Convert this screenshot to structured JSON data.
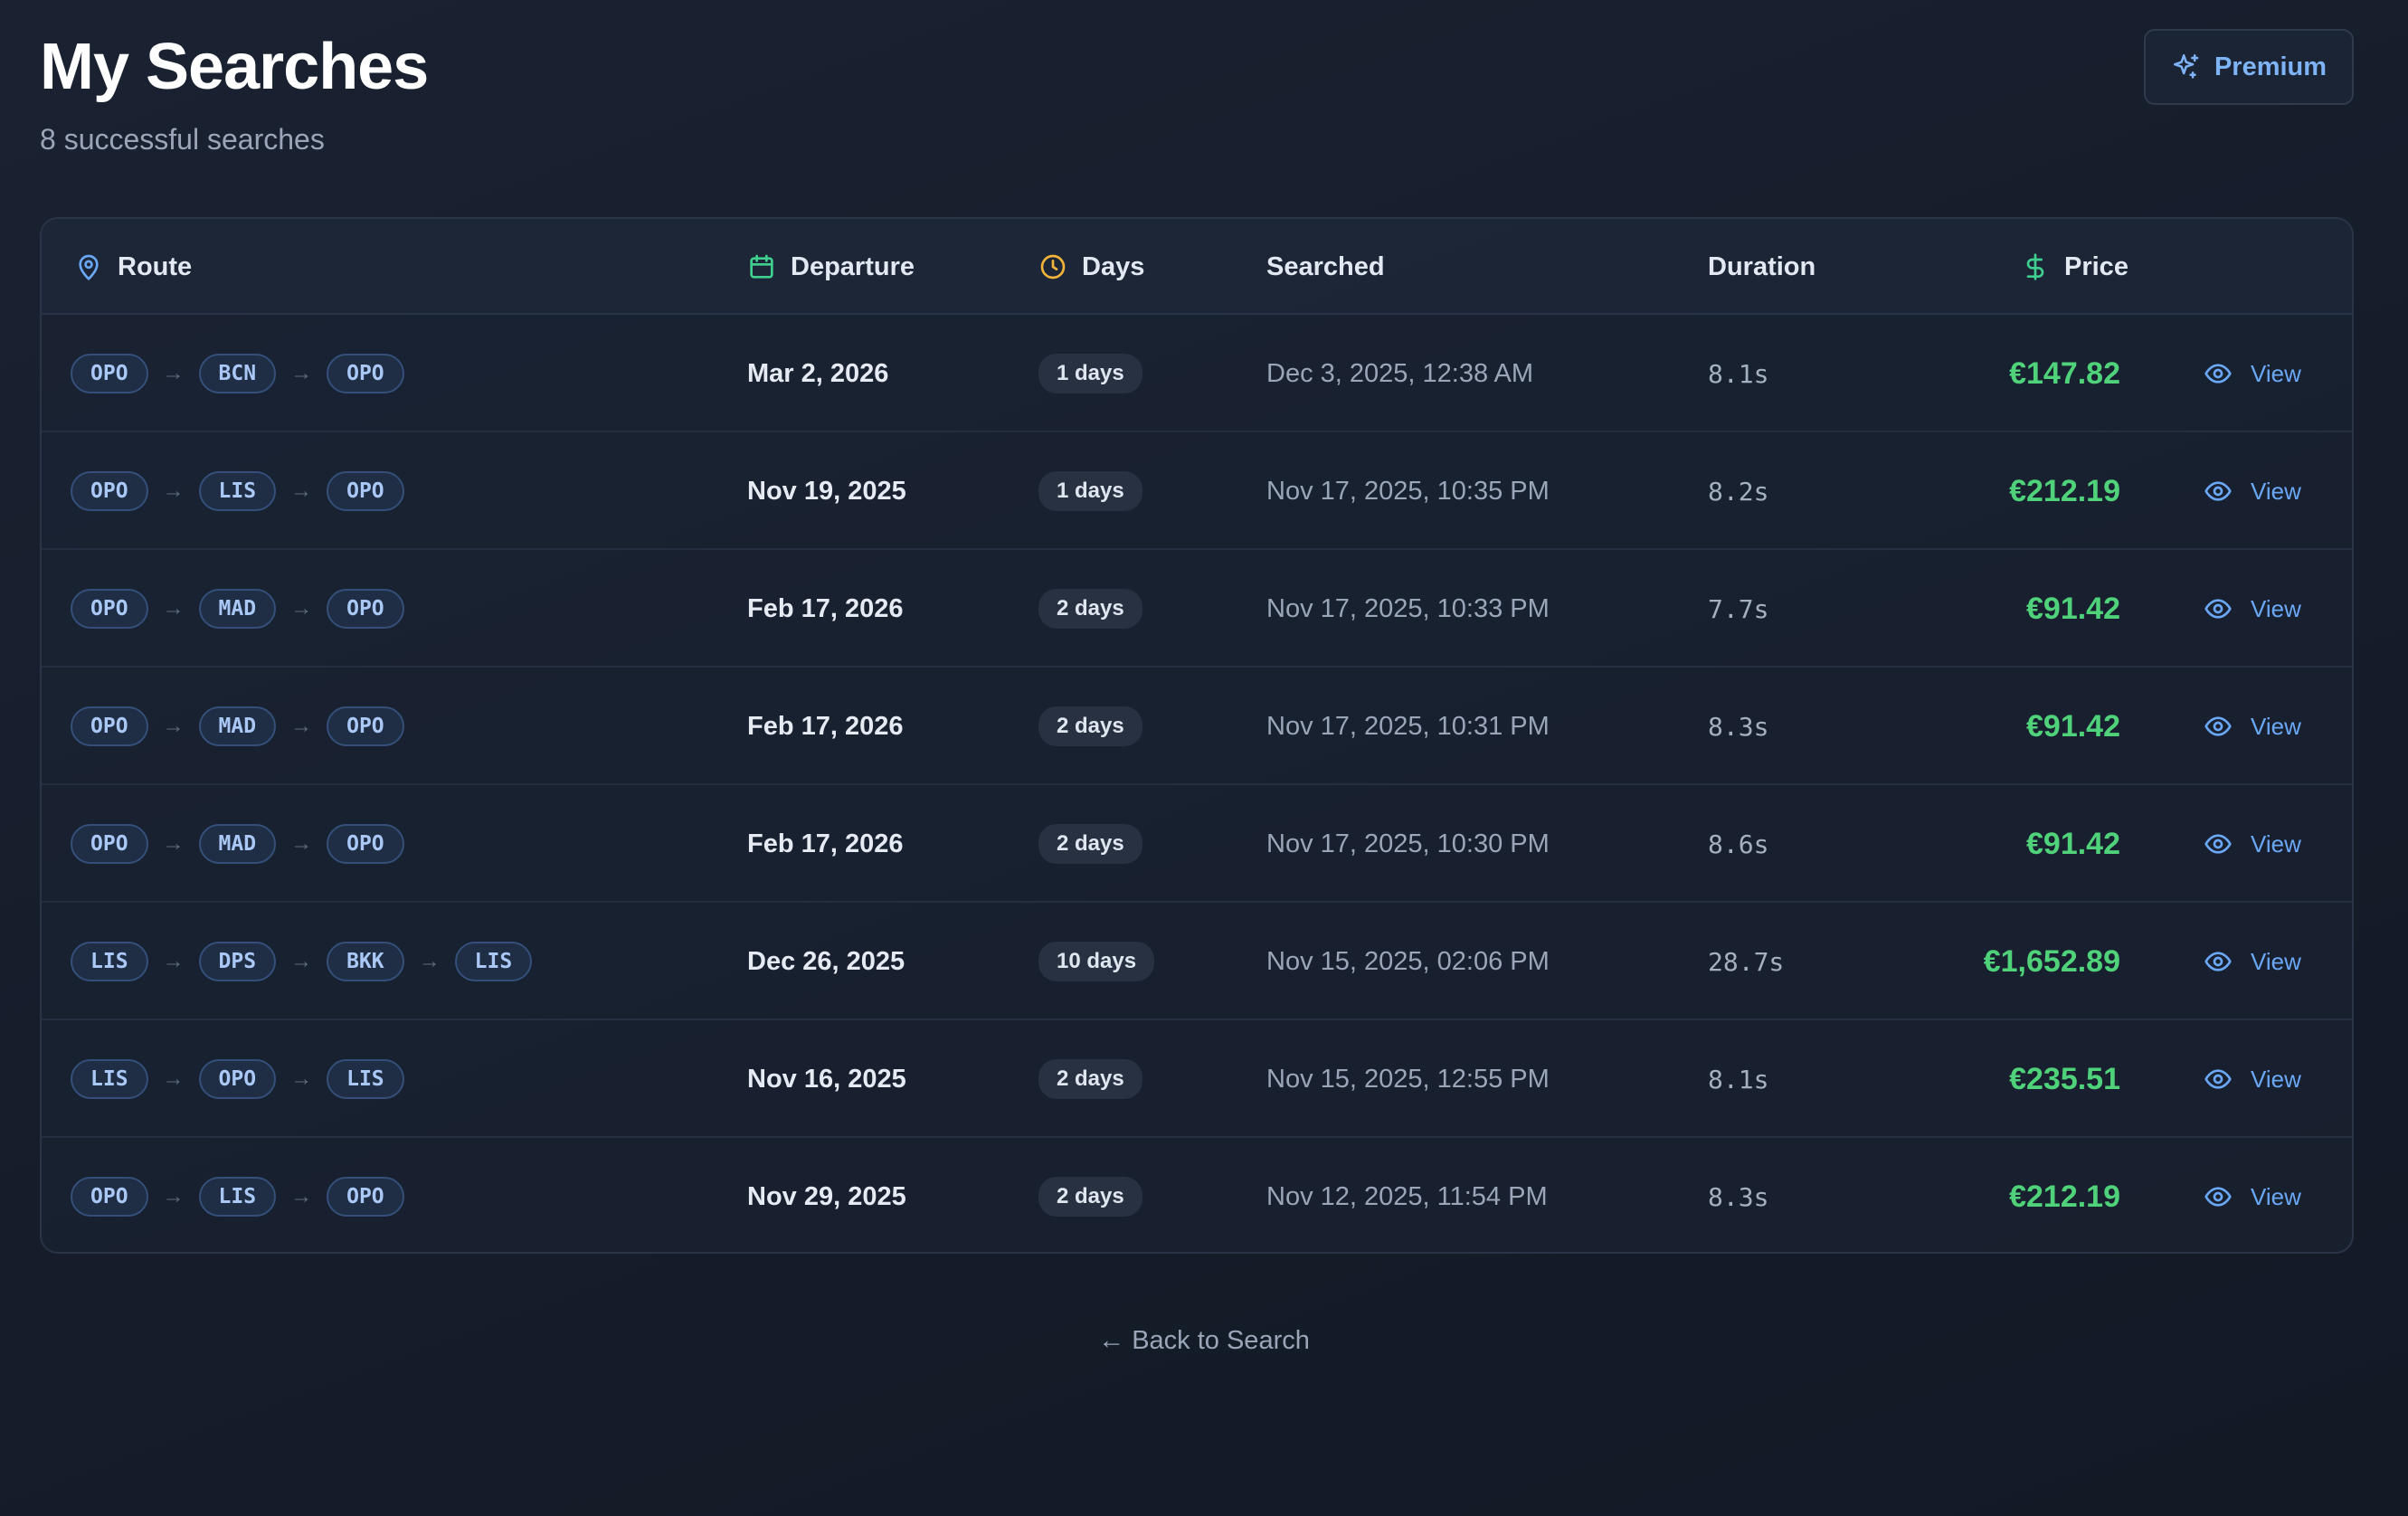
{
  "header": {
    "title": "My Searches",
    "subtitle": "8 successful searches",
    "premium_label": "Premium"
  },
  "table": {
    "columns": {
      "route": "Route",
      "departure": "Departure",
      "days": "Days",
      "searched": "Searched",
      "duration": "Duration",
      "price": "Price"
    },
    "rows": [
      {
        "route": [
          "OPO",
          "BCN",
          "OPO"
        ],
        "departure": "Mar 2, 2026",
        "days": "1 days",
        "searched": "Dec 3, 2025, 12:38 AM",
        "duration": "8.1s",
        "price": "€147.82",
        "view": "View"
      },
      {
        "route": [
          "OPO",
          "LIS",
          "OPO"
        ],
        "departure": "Nov 19, 2025",
        "days": "1 days",
        "searched": "Nov 17, 2025, 10:35 PM",
        "duration": "8.2s",
        "price": "€212.19",
        "view": "View"
      },
      {
        "route": [
          "OPO",
          "MAD",
          "OPO"
        ],
        "departure": "Feb 17, 2026",
        "days": "2 days",
        "searched": "Nov 17, 2025, 10:33 PM",
        "duration": "7.7s",
        "price": "€91.42",
        "view": "View"
      },
      {
        "route": [
          "OPO",
          "MAD",
          "OPO"
        ],
        "departure": "Feb 17, 2026",
        "days": "2 days",
        "searched": "Nov 17, 2025, 10:31 PM",
        "duration": "8.3s",
        "price": "€91.42",
        "view": "View"
      },
      {
        "route": [
          "OPO",
          "MAD",
          "OPO"
        ],
        "departure": "Feb 17, 2026",
        "days": "2 days",
        "searched": "Nov 17, 2025, 10:30 PM",
        "duration": "8.6s",
        "price": "€91.42",
        "view": "View"
      },
      {
        "route": [
          "LIS",
          "DPS",
          "BKK",
          "LIS"
        ],
        "departure": "Dec 26, 2025",
        "days": "10 days",
        "searched": "Nov 15, 2025, 02:06 PM",
        "duration": "28.7s",
        "price": "€1,652.89",
        "view": "View"
      },
      {
        "route": [
          "LIS",
          "OPO",
          "LIS"
        ],
        "departure": "Nov 16, 2025",
        "days": "2 days",
        "searched": "Nov 15, 2025, 12:55 PM",
        "duration": "8.1s",
        "price": "€235.51",
        "view": "View"
      },
      {
        "route": [
          "OPO",
          "LIS",
          "OPO"
        ],
        "departure": "Nov 29, 2025",
        "days": "2 days",
        "searched": "Nov 12, 2025, 11:54 PM",
        "duration": "8.3s",
        "price": "€212.19",
        "view": "View"
      }
    ]
  },
  "footer": {
    "back_label": "← Back to Search"
  },
  "icons": {
    "premium": "sparkles-icon",
    "route": "map-pin-icon",
    "departure": "calendar-icon",
    "days": "clock-icon",
    "price": "dollar-icon",
    "view": "eye-icon"
  },
  "colors": {
    "accent": "#6aa8f5",
    "price": "#4fd27a",
    "days_icon": "#f2b43a",
    "departure_icon": "#3fcf8e"
  }
}
